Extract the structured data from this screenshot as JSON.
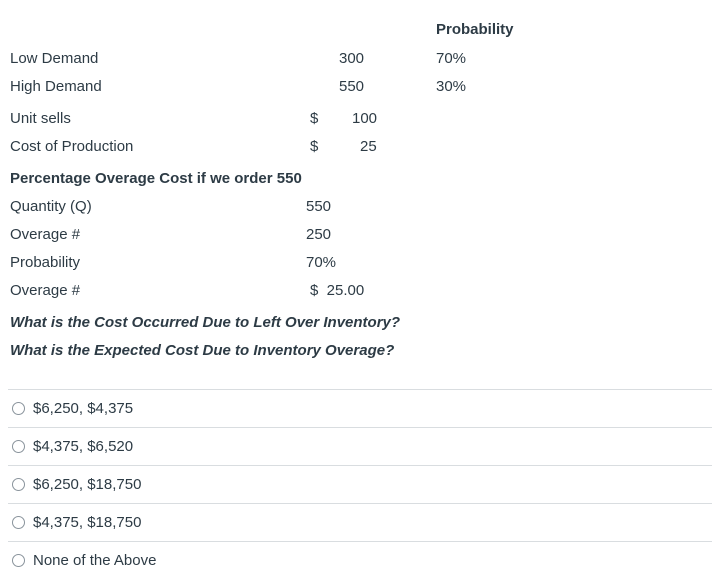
{
  "table": {
    "prob_header": "Probability",
    "low_demand": {
      "label": "Low Demand",
      "value": "300",
      "prob": "70%"
    },
    "high_demand": {
      "label": "High Demand",
      "value": "550",
      "prob": "30%"
    },
    "unit_sells": {
      "label": "Unit sells",
      "currency": "$",
      "value": "100"
    },
    "cost_production": {
      "label": "Cost of Production",
      "currency": "$",
      "value": "25"
    }
  },
  "section": {
    "title": "Percentage Overage Cost if we order 550",
    "quantity": {
      "label": "Quantity (Q)",
      "value": "550"
    },
    "overage_count": {
      "label": "Overage #",
      "value": "250"
    },
    "probability": {
      "label": "Probability",
      "value": "70%"
    },
    "overage_cost": {
      "label": "Overage #",
      "value": "$  25.00"
    }
  },
  "questions": {
    "q1": "What is the Cost Occurred Due to Left Over Inventory?",
    "q2": "What is the Expected Cost Due to Inventory Overage?"
  },
  "options": [
    {
      "label": "$6,250, $4,375"
    },
    {
      "label": "$4,375, $6,520"
    },
    {
      "label": "$6,250, $18,750"
    },
    {
      "label": "$4,375, $18,750"
    },
    {
      "label": "None of the Above"
    }
  ]
}
